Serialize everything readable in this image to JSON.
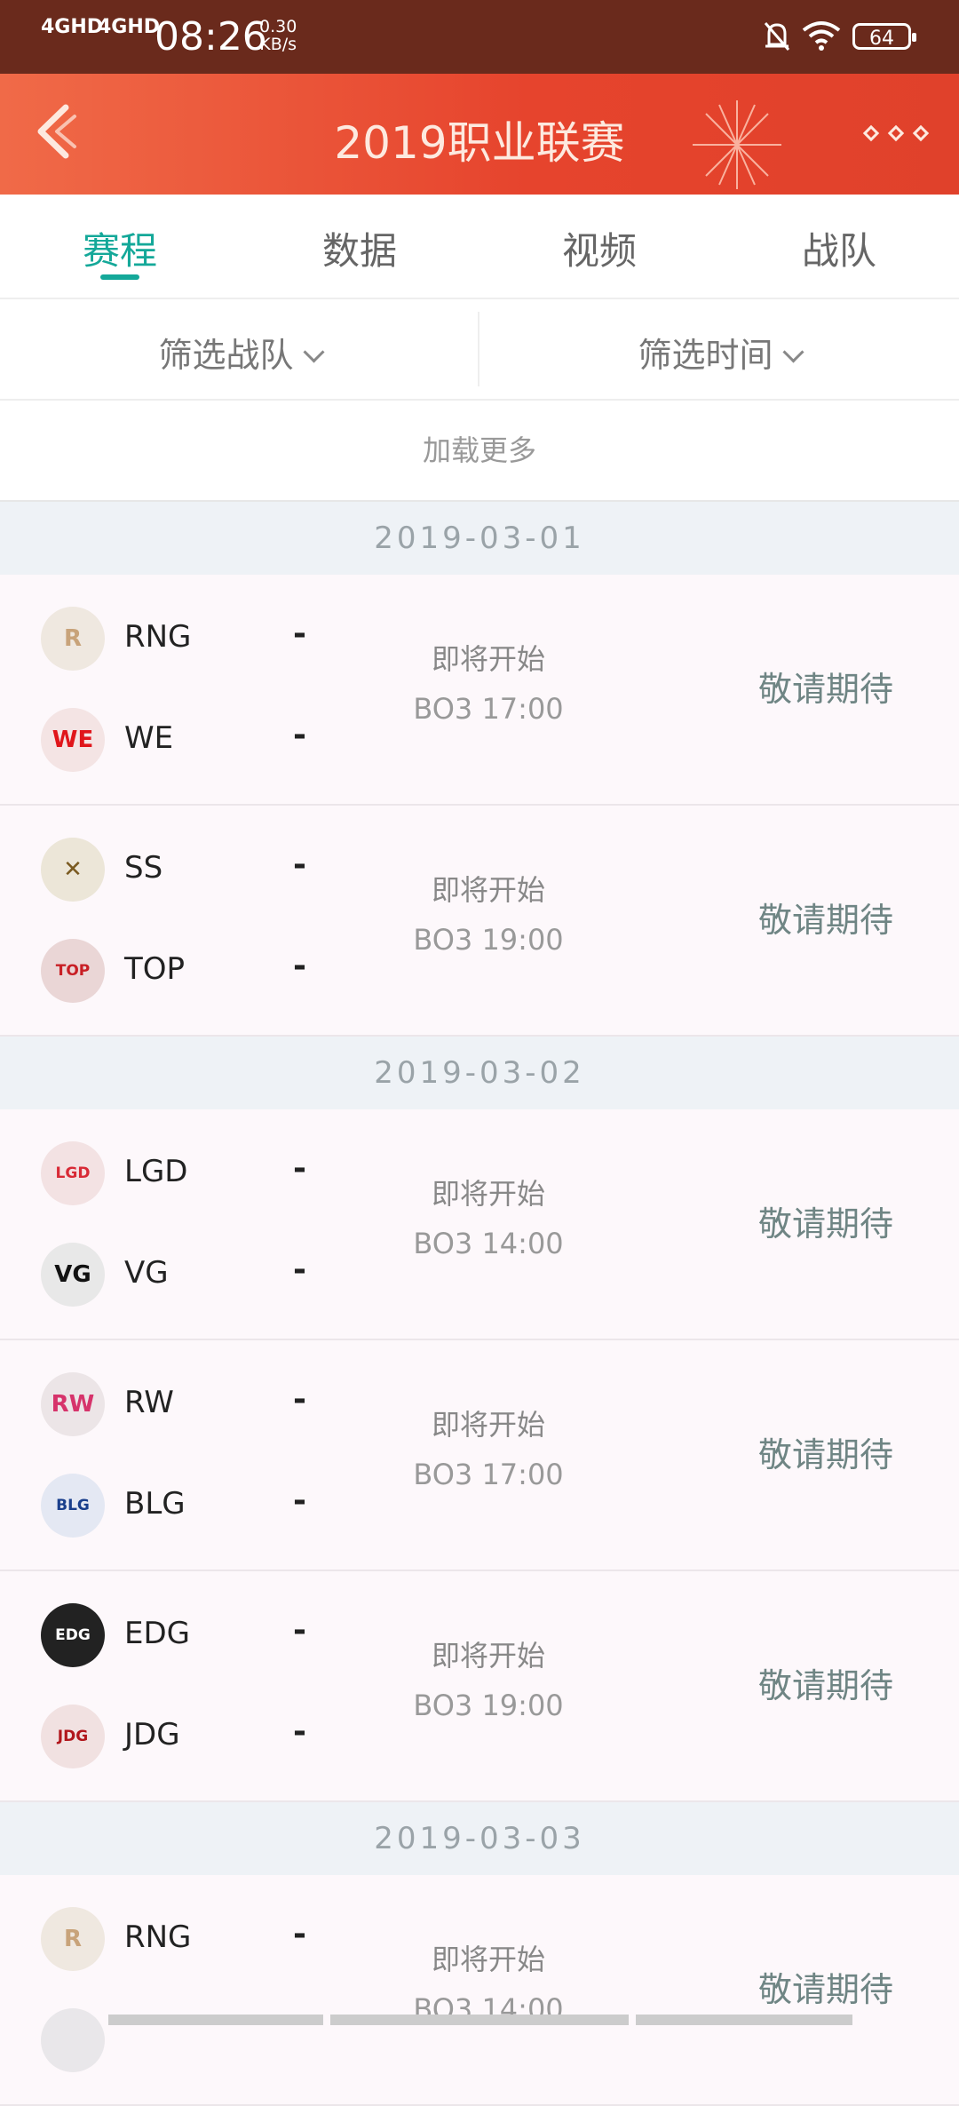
{
  "status_bar": {
    "signal1": "4GHD",
    "signal2": "4GHD",
    "time": "08:26",
    "speed_value": "0.30",
    "speed_unit": "KB/s",
    "battery": "64"
  },
  "header": {
    "title": "2019职业联赛"
  },
  "tabs": [
    {
      "label": "赛程",
      "active": true
    },
    {
      "label": "数据",
      "active": false
    },
    {
      "label": "视频",
      "active": false
    },
    {
      "label": "战队",
      "active": false
    }
  ],
  "filters": {
    "team": "筛选战队",
    "time": "筛选时间"
  },
  "load_more": "加载更多",
  "schedule": [
    {
      "date": "2019-03-01",
      "matches": [
        {
          "team1": "RNG",
          "score1": "-",
          "team2": "WE",
          "score2": "-",
          "status": "即将开始",
          "detail": "BO3 17:00",
          "action": "敬请期待"
        },
        {
          "team1": "SS",
          "score1": "-",
          "team2": "TOP",
          "score2": "-",
          "status": "即将开始",
          "detail": "BO3 19:00",
          "action": "敬请期待"
        }
      ]
    },
    {
      "date": "2019-03-02",
      "matches": [
        {
          "team1": "LGD",
          "score1": "-",
          "team2": "VG",
          "score2": "-",
          "status": "即将开始",
          "detail": "BO3 14:00",
          "action": "敬请期待"
        },
        {
          "team1": "RW",
          "score1": "-",
          "team2": "BLG",
          "score2": "-",
          "status": "即将开始",
          "detail": "BO3 17:00",
          "action": "敬请期待"
        },
        {
          "team1": "EDG",
          "score1": "-",
          "team2": "JDG",
          "score2": "-",
          "status": "即将开始",
          "detail": "BO3 19:00",
          "action": "敬请期待"
        }
      ]
    },
    {
      "date": "2019-03-03",
      "matches": [
        {
          "team1": "RNG",
          "score1": "-",
          "team2": "",
          "score2": "",
          "status": "即将开始",
          "detail": "BO3 14:00",
          "action": "敬请期待"
        }
      ]
    }
  ],
  "colors": {
    "accent": "#14a899",
    "header": "#e6442d"
  }
}
